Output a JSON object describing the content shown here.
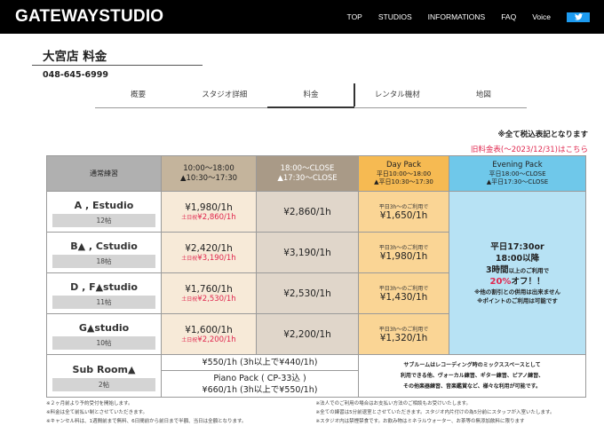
{
  "header": {
    "logo": "GATEWAYSTUDIO",
    "nav": [
      "TOP",
      "STUDIOS",
      "INFORMATIONS",
      "FAQ",
      "Voice"
    ],
    "twitter_icon": "twitter-icon",
    "brand_color": "#1d9bf0"
  },
  "page": {
    "title": "大宮店 料金",
    "phone": "048-645-6999"
  },
  "tabs": [
    "概要",
    "スタジオ詳細",
    "料金",
    "レンタル機材",
    "地図"
  ],
  "active_tab": "料金",
  "tax_note": "※全て税込表記となります",
  "old_price_link": "旧料金表(〜2023/12/31)はこちら",
  "table": {
    "headers": {
      "regular": "通常練習",
      "day_line1": "10:00〜18:00",
      "day_line2": "▲10:30〜17:30",
      "close_line1": "18:00〜CLOSE",
      "close_line2": "▲17:30〜CLOSE",
      "daypack_title": "Day Pack",
      "daypack_sub1": "平日10:00〜18:00",
      "daypack_sub2": "▲平日10:30〜17:30",
      "evening_title": "Evening Pack",
      "evening_sub1": "平日18:00〜CLOSE",
      "evening_sub2": "▲平日17:30〜CLOSE"
    },
    "rows": [
      {
        "studio": "A , Estudio",
        "size": "12帖",
        "day": "¥1,980/1h",
        "weekend_label": "土日祝",
        "weekend": "¥2,860/1h",
        "close": "¥2,860/1h",
        "dp_note": "平日3h〜のご利用で",
        "dp": "¥1,650/1h"
      },
      {
        "studio": "B▲ , Cstudio",
        "size": "18帖",
        "day": "¥2,420/1h",
        "weekend_label": "土日祝",
        "weekend": "¥3,190/1h",
        "close": "¥3,190/1h",
        "dp_note": "平日3h〜のご利用で",
        "dp": "¥1,980/1h"
      },
      {
        "studio": "D , F▲studio",
        "size": "11帖",
        "day": "¥1,760/1h",
        "weekend_label": "土日祝",
        "weekend": "¥2,530/1h",
        "close": "¥2,530/1h",
        "dp_note": "平日3h〜のご利用で",
        "dp": "¥1,430/1h"
      },
      {
        "studio": "G▲studio",
        "size": "10帖",
        "day": "¥1,600/1h",
        "weekend_label": "土日祝",
        "weekend": "¥2,200/1h",
        "close": "¥2,200/1h",
        "dp_note": "平日3h〜のご利用で",
        "dp": "¥1,320/1h"
      }
    ],
    "evening": {
      "line1": "平日17:30or",
      "line2": "18:00以降",
      "line3": "3時間",
      "line3b": "以上のご利用で",
      "pct": "20%",
      "pct_suffix": "オフ！！",
      "note1": "※他の割引との併用は出来ません",
      "note2": "※ポイントのご利用は可能です"
    },
    "subroom": {
      "name": "Sub Room▲",
      "size": "2帖",
      "price1": "¥550/1h (3h以上で¥440/1h)",
      "piano_label": "Piano Pack ( CP-33込 )",
      "price2": "¥660/1h (3h以上で¥550/1h)",
      "desc1": "サブルームはレコーディング時のミックススペースとして",
      "desc2": "利用できる他、ヴォーカル練習、ギター練習、ピアノ練習、",
      "desc3": "その他楽器練習、音楽鑑賞など、様々な利用が可能です。"
    }
  },
  "notes": {
    "left": [
      "※２ヶ月前より予約受付を開始します。",
      "※料金は全て前払い制とさせていただきます。",
      "※キャンセル料は、1週間前まで無料、6日間前から前日まで半額、当日は全額となります。"
    ],
    "right": [
      "※法人でのご利用の場合はお支払い方法のご相談もお受けいたします。",
      "※全ての練習は5分前退室とさせていただきます。スタジオ内片付けの為5分前にスタッフが入室いたします。",
      "※スタジオ内は禁煙禁食です。お飲み物はミネラルウォーター、お茶等の無添加飲料に限ります"
    ]
  }
}
